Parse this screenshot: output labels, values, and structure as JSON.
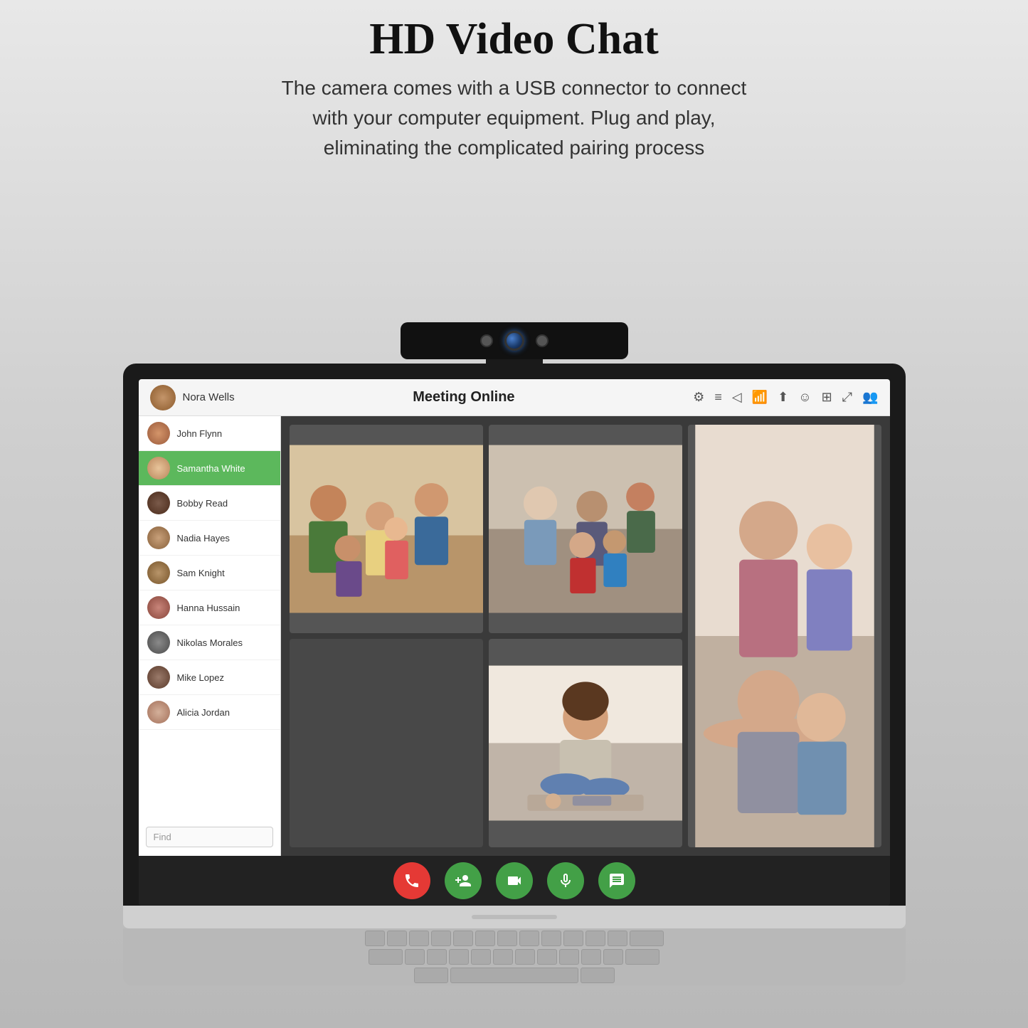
{
  "page": {
    "title": "HD Video Chat",
    "subtitle": "The camera comes with a USB connector to connect with your computer equipment. Plug and play, eliminating the complicated pairing process"
  },
  "app": {
    "header": {
      "user": "Nora Wells",
      "meeting_title": "Meeting Online"
    },
    "header_icons": [
      "⚙",
      "≡",
      "◁",
      "📶",
      "⬆",
      "☺",
      "⊞",
      "⤢",
      "👥"
    ],
    "sidebar": {
      "find_placeholder": "Find",
      "participants": [
        {
          "id": 1,
          "name": "John Flynn",
          "avatar_class": "av-john",
          "active": false
        },
        {
          "id": 2,
          "name": "Samantha White",
          "avatar_class": "av-samantha",
          "active": true
        },
        {
          "id": 3,
          "name": "Bobby Read",
          "avatar_class": "av-bobby",
          "active": false
        },
        {
          "id": 4,
          "name": "Nadia Hayes",
          "avatar_class": "av-nadia",
          "active": false
        },
        {
          "id": 5,
          "name": "Sam Knight",
          "avatar_class": "av-sam",
          "active": false
        },
        {
          "id": 6,
          "name": "Hanna Hussain",
          "avatar_class": "av-hanna",
          "active": false
        },
        {
          "id": 7,
          "name": "Nikolas Morales",
          "avatar_class": "av-nikolas",
          "active": false
        },
        {
          "id": 8,
          "name": "Mike Lopez",
          "avatar_class": "av-mike",
          "active": false
        },
        {
          "id": 9,
          "name": "Alicia Jordan",
          "avatar_class": "av-alicia",
          "active": false
        }
      ]
    },
    "controls": [
      {
        "id": "end-call",
        "icon": "📞",
        "color": "red",
        "label": "End call"
      },
      {
        "id": "add-person",
        "icon": "👤+",
        "color": "green",
        "label": "Add person"
      },
      {
        "id": "video",
        "icon": "🎥",
        "color": "green",
        "label": "Video"
      },
      {
        "id": "microphone",
        "icon": "🎤",
        "color": "green",
        "label": "Microphone"
      },
      {
        "id": "chat",
        "icon": "💬",
        "color": "green",
        "label": "Chat"
      }
    ]
  }
}
